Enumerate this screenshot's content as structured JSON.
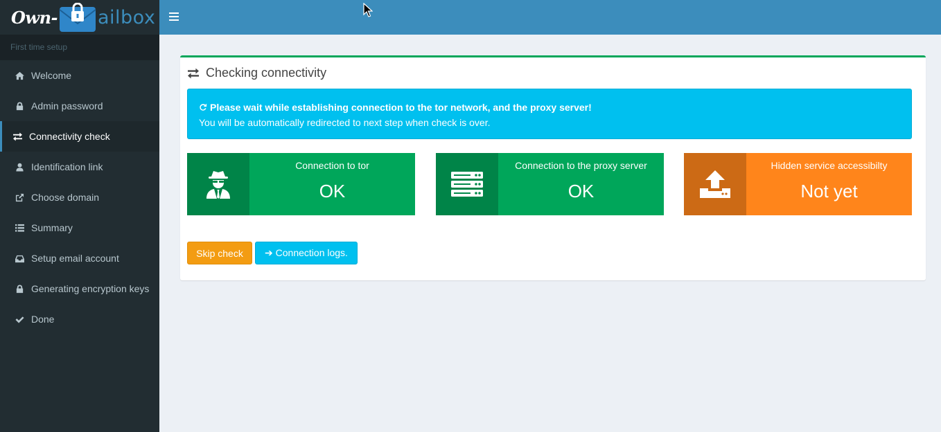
{
  "brand": {
    "logo_left": "Own-",
    "logo_right": "ailbox"
  },
  "sidebar": {
    "header": "First time setup",
    "items": [
      {
        "label": "Welcome",
        "icon": "home-icon",
        "active": false
      },
      {
        "label": "Admin password",
        "icon": "lock-icon",
        "active": false
      },
      {
        "label": "Connectivity check",
        "icon": "exchange-icon",
        "active": true
      },
      {
        "label": "Identification link",
        "icon": "user-icon",
        "active": false
      },
      {
        "label": "Choose domain",
        "icon": "external-link-icon",
        "active": false
      },
      {
        "label": "Summary",
        "icon": "list-icon",
        "active": false
      },
      {
        "label": "Setup email account",
        "icon": "inbox-icon",
        "active": false
      },
      {
        "label": "Generating encryption keys",
        "icon": "lock-icon",
        "active": false
      },
      {
        "label": "Done",
        "icon": "check-icon",
        "active": false
      }
    ]
  },
  "main": {
    "title": "Checking connectivity",
    "callout": {
      "line1": "Please wait while establishing connection to the tor network, and the proxy server!",
      "line2": "You will be automatically redirected to next step when check is over."
    },
    "cards": [
      {
        "label": "Connection to tor",
        "value": "OK",
        "icon": "user-secret-icon",
        "color": "#00a65a"
      },
      {
        "label": "Connection to the proxy server",
        "value": "OK",
        "icon": "server-icon",
        "color": "#00a65a"
      },
      {
        "label": "Hidden service accessibilty",
        "value": "Not yet",
        "icon": "upload-icon",
        "color": "#ff851b"
      }
    ],
    "buttons": {
      "skip": "Skip check",
      "logs": "➔ Connection logs."
    }
  },
  "colors": {
    "header": "#3c8dbc",
    "sidebar": "#222d32",
    "success": "#00a65a",
    "orange": "#ff851b",
    "info": "#00c0ef",
    "warning": "#f39c12"
  }
}
